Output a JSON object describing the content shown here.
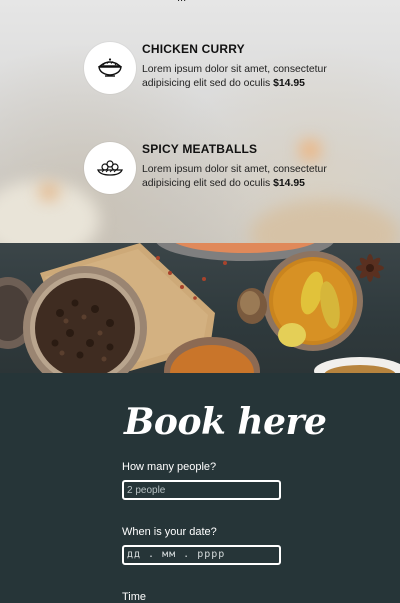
{
  "menu": {
    "top_fragment": "...",
    "items": [
      {
        "icon": "curry-bowl-icon",
        "title": "CHICKEN CURRY",
        "description": "Lorem ipsum dolor sit amet, consectetur adipisicing elit sed do oculis",
        "price": "$14.95"
      },
      {
        "icon": "meatballs-plate-icon",
        "title": "SPICY MEATBALLS",
        "description": "Lorem ipsum dolor sit amet, consectetur adipisicing elit sed do oculis",
        "price": "$14.95"
      }
    ]
  },
  "spices_image": "spices-photo",
  "booking": {
    "title": "Book here",
    "people_label": "How many people?",
    "people_placeholder": "2 people",
    "date_label": "When is your date?",
    "date_placeholder": "дд . мм . рррр",
    "time_label": "Time"
  },
  "colors": {
    "booking_bg": "#263538",
    "text_light": "#ffffff",
    "icon_circle": "#ffffff"
  }
}
